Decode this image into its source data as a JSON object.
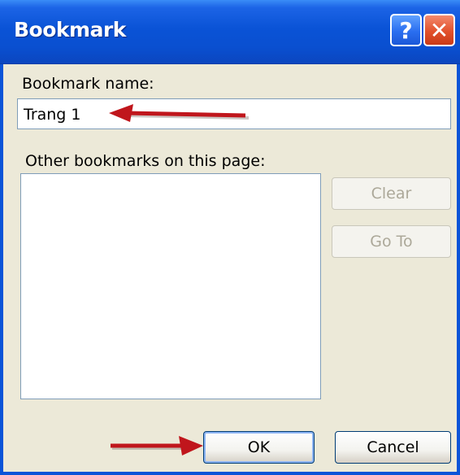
{
  "window": {
    "title": "Bookmark",
    "help_label": "?",
    "close_label": "✕"
  },
  "form": {
    "name_label": "Bookmark name:",
    "name_value": "Trang 1",
    "others_label": "Other bookmarks on this page:"
  },
  "buttons": {
    "clear": "Clear",
    "goto": "Go To",
    "ok": "OK",
    "cancel": "Cancel"
  },
  "colors": {
    "titlebar": "#0a53d6",
    "annotation_arrow": "#c0161c"
  }
}
